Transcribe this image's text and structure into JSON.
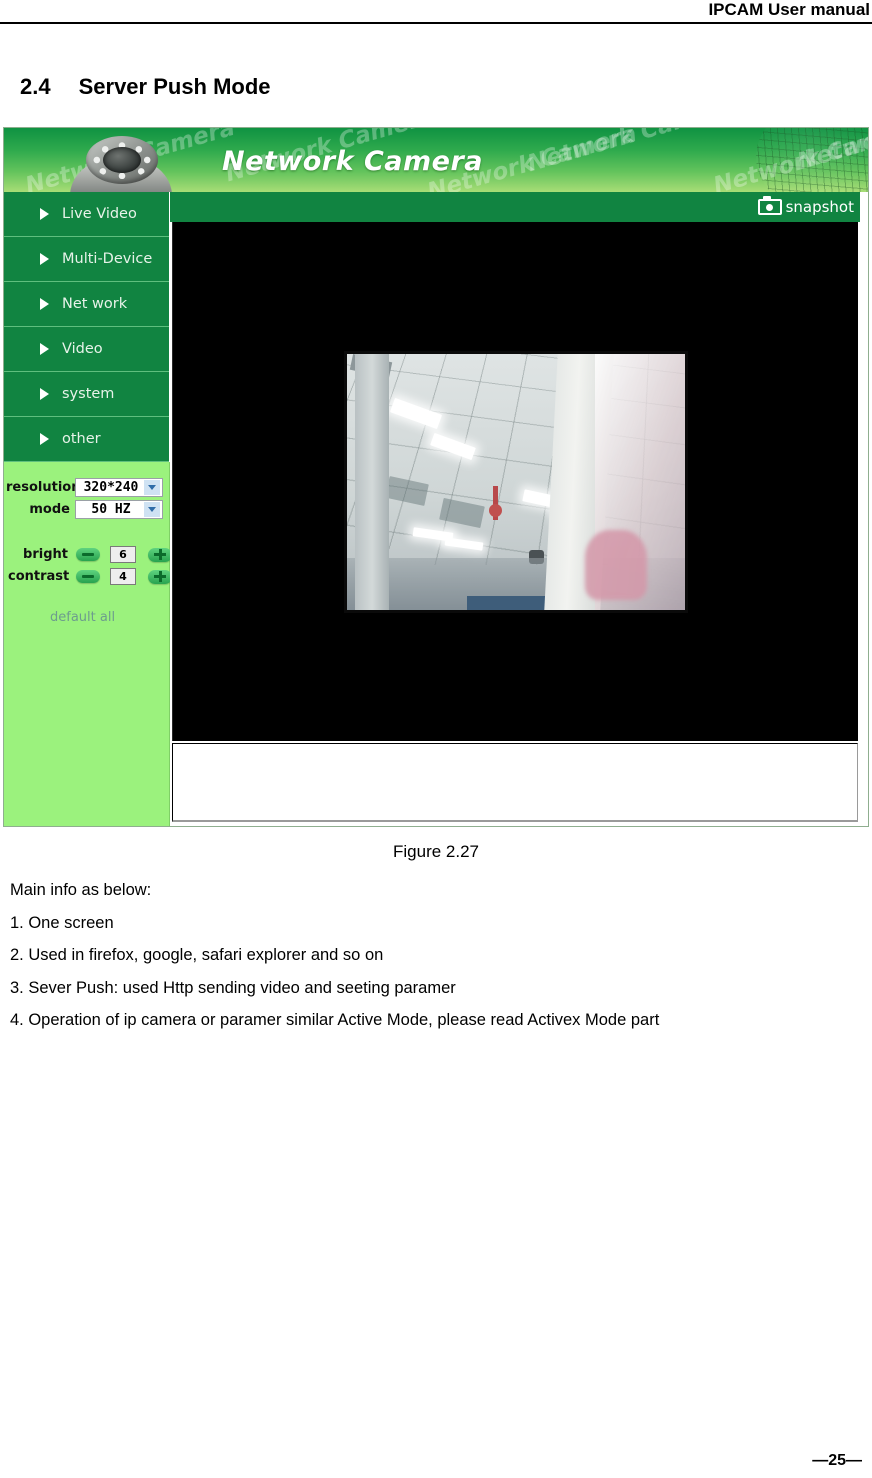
{
  "document": {
    "header_title": "IPCAM User manual",
    "section_number": "2.4",
    "section_title": "Server Push Mode",
    "figure_caption": "Figure 2.27",
    "page_number": "—25—"
  },
  "body": {
    "intro": "Main info as below:",
    "items": [
      "1. One screen",
      "2. Used in firefox, google, safari explorer and so on",
      "3. Sever Push: used Http sending video and seeting paramer",
      "4. Operation of ip camera or paramer similar Active Mode, please read Activex Mode part"
    ]
  },
  "screenshot": {
    "banner": {
      "title": "Network Camera",
      "watermark": "Network Camera",
      "logo_icon": "dome-camera-icon",
      "globe_icon": "globe-graphic-icon"
    },
    "menu": {
      "items": [
        {
          "label": "Live Video",
          "icon": "triangle-right-icon"
        },
        {
          "label": "Multi-Device",
          "icon": "triangle-right-icon"
        },
        {
          "label": "Net work",
          "icon": "triangle-right-icon"
        },
        {
          "label": "Video",
          "icon": "triangle-right-icon"
        },
        {
          "label": "system",
          "icon": "triangle-right-icon"
        },
        {
          "label": "other",
          "icon": "triangle-right-icon"
        }
      ]
    },
    "controls": {
      "resolution_label": "resolution",
      "resolution_value": "320*240",
      "mode_label": "mode",
      "mode_value": "50 HZ",
      "bright_label": "bright",
      "bright_value": "6",
      "contrast_label": "contrast",
      "contrast_value": "4",
      "minus_icon": "minus-icon",
      "plus_icon": "plus-icon",
      "default_all_label": "default all"
    },
    "toolbar": {
      "snapshot_label": "snapshot",
      "snapshot_icon": "camera-icon"
    },
    "video": {
      "alt": "live-video-stream-ceiling-view"
    }
  },
  "colors": {
    "menu_green": "#118441",
    "panel_green": "#9bf27d",
    "banner_dark": "#0f9242",
    "banner_light": "#a8dd76",
    "link_gray": "#6d9d8d"
  }
}
